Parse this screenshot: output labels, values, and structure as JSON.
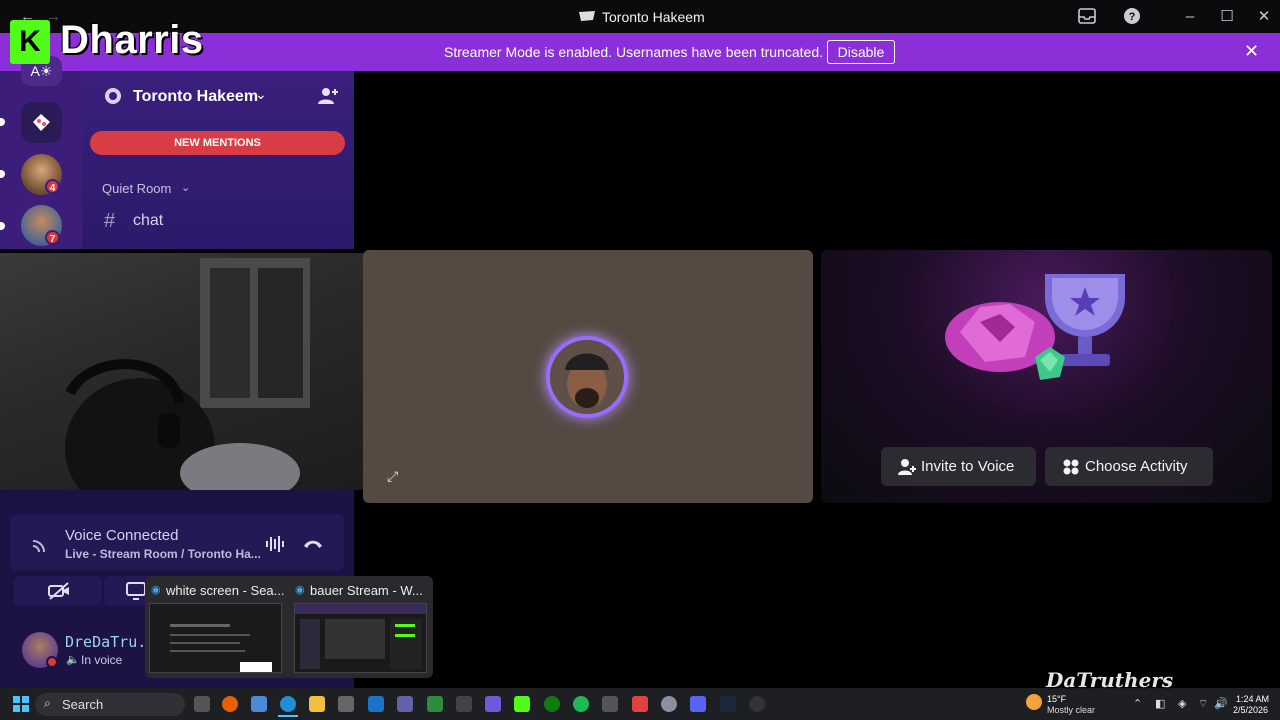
{
  "window": {
    "title": "Toronto Hakeem",
    "back_glyph": "←",
    "forward_glyph": "→"
  },
  "banner": {
    "text": "Streamer Mode is enabled. Usernames have been truncated.",
    "button": "Disable"
  },
  "overlay": {
    "kick_letter": "K",
    "streamer_name": "Dharris"
  },
  "server_rail": {
    "badges": [
      "4",
      "7"
    ]
  },
  "channel_panel": {
    "server_name": "Toronto Hakeem",
    "mentions_label": "NEW MENTIONS",
    "category": "Quiet Room",
    "channel": "chat"
  },
  "voice": {
    "title": "Voice Connected",
    "subtitle": "Live - Stream Room / Toronto Ha..."
  },
  "user": {
    "name": "DreDaTru...",
    "status": "In voice"
  },
  "activity": {
    "invite_label": "Invite to Voice",
    "choose_label": "Choose Activity"
  },
  "taskbar_preview": {
    "items": [
      {
        "title": "white screen - Sea..."
      },
      {
        "title": "bauer Stream - W..."
      }
    ]
  },
  "taskbar": {
    "search_label": "Search",
    "weather_temp": "15°F",
    "weather_desc": "Mostly clear",
    "time": "1:24 AM",
    "date": "2/5/2026"
  },
  "watermark": "DaTruthers",
  "colors": {
    "banner": "#8b2fd9",
    "mentions": "#d83c45",
    "kick_green": "#53fc18",
    "accent": "#9a6bff"
  }
}
